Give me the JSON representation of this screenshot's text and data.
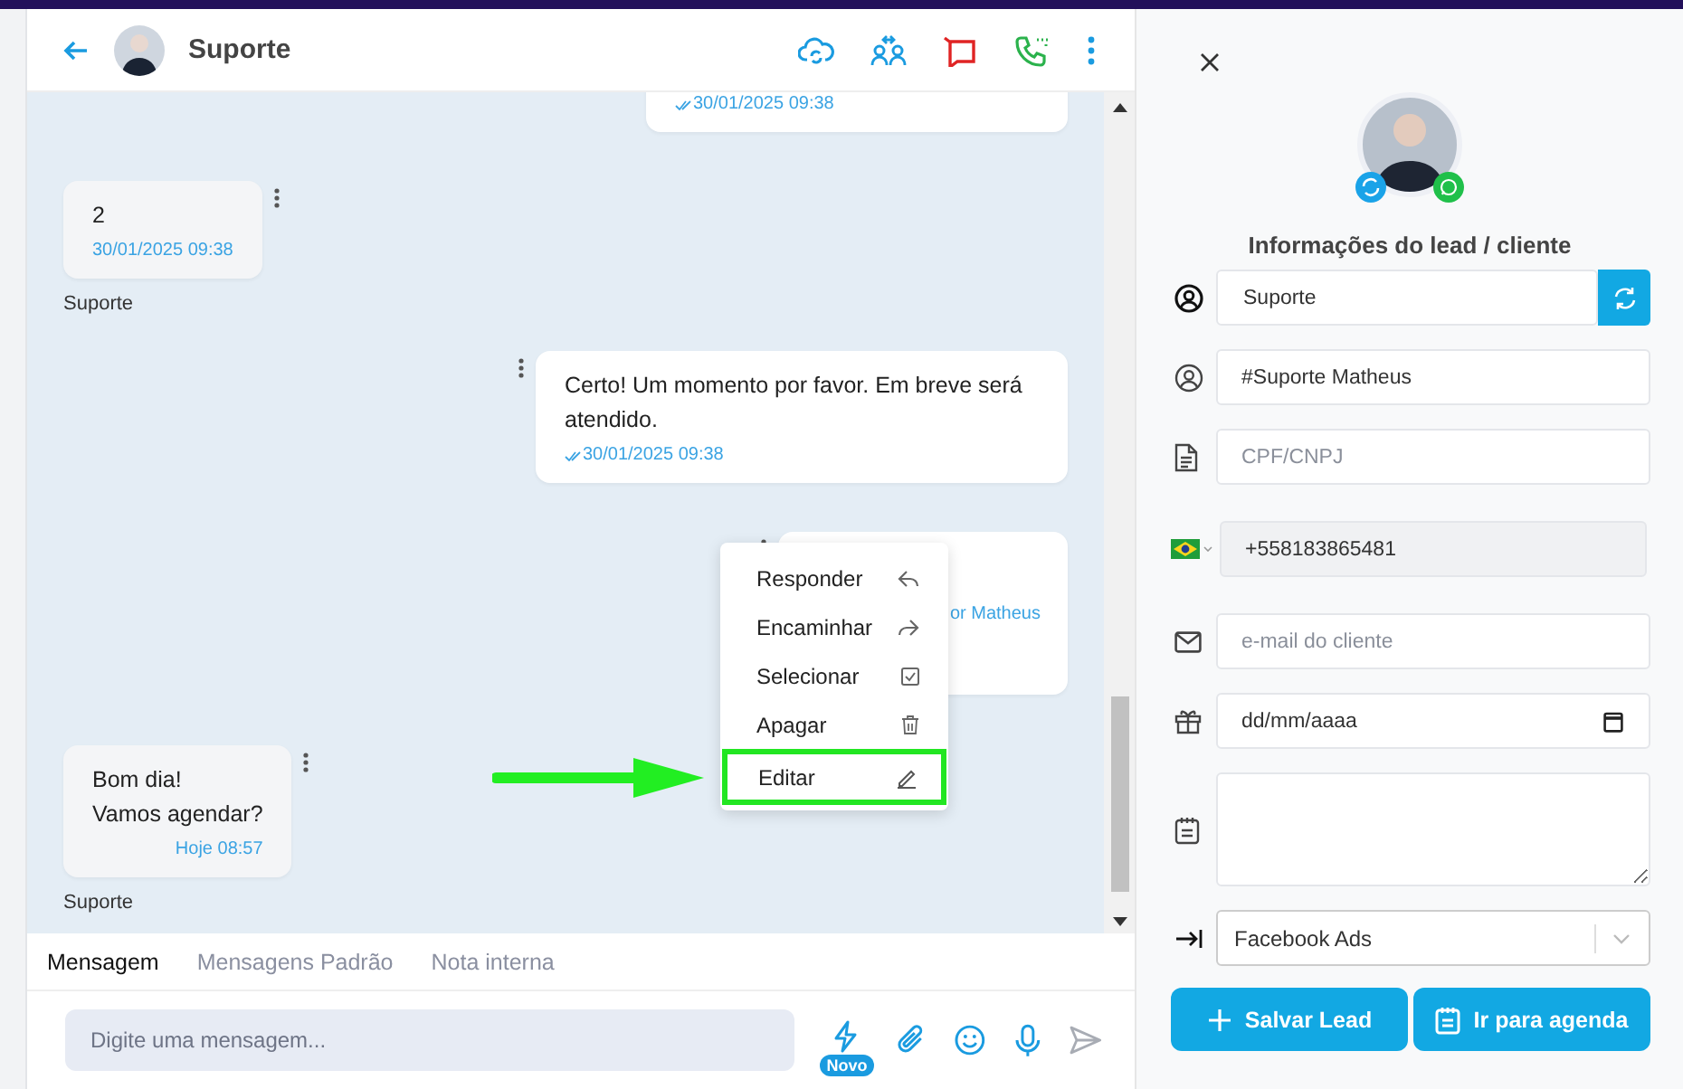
{
  "header": {
    "contact_name": "Suporte"
  },
  "messages": [
    {
      "kind": "outgoing",
      "time": "30/01/2025 09:38",
      "read": true
    },
    {
      "kind": "incoming",
      "text": "2",
      "time": "30/01/2025 09:38",
      "sender": "Suporte",
      "read": false
    },
    {
      "kind": "outgoing",
      "text": "Certo! Um momento por favor. Em breve será atendido.",
      "time": "30/01/2025 09:38",
      "read": true
    },
    {
      "kind": "outgoing",
      "signature": "or Matheus"
    },
    {
      "kind": "incoming",
      "text": "Bom dia!\nVamos agendar?",
      "time": "Hoje 08:57",
      "sender": "Suporte",
      "read": false
    }
  ],
  "context_menu": {
    "items": [
      {
        "label": "Responder",
        "kind": "reply",
        "selected": false
      },
      {
        "label": "Encaminhar",
        "kind": "forward",
        "selected": false
      },
      {
        "label": "Selecionar",
        "kind": "select",
        "selected": false
      },
      {
        "label": "Apagar",
        "kind": "delete",
        "selected": false
      },
      {
        "label": "Editar",
        "kind": "edit",
        "selected": true
      }
    ]
  },
  "composer": {
    "tabs": [
      {
        "label": "Mensagem",
        "selected": true
      },
      {
        "label": "Mensagens Padrão",
        "selected": false
      },
      {
        "label": "Nota interna",
        "selected": false
      }
    ],
    "placeholder": "Digite uma mensagem...",
    "badge": "Novo"
  },
  "lead_panel": {
    "title": "Informações do lead / cliente",
    "fields": [
      {
        "kind": "name",
        "value": "Suporte",
        "disabled": false
      },
      {
        "kind": "nickname",
        "value": "#Suporte Matheus",
        "disabled": false
      },
      {
        "kind": "document",
        "placeholder": "CPF/CNPJ",
        "disabled": false
      },
      {
        "kind": "phone",
        "value": "+558183865481",
        "disabled": true
      },
      {
        "kind": "email",
        "placeholder": "e-mail do cliente",
        "disabled": false
      },
      {
        "kind": "date",
        "value": "dd/mm/aaaa",
        "disabled": false
      },
      {
        "kind": "notes",
        "disabled": false
      },
      {
        "kind": "source",
        "value": "Facebook Ads",
        "disabled": false
      }
    ],
    "buttons": [
      {
        "label": "Salvar Lead",
        "kind": "save"
      },
      {
        "label": "Ir para agenda",
        "kind": "calendar"
      }
    ]
  }
}
